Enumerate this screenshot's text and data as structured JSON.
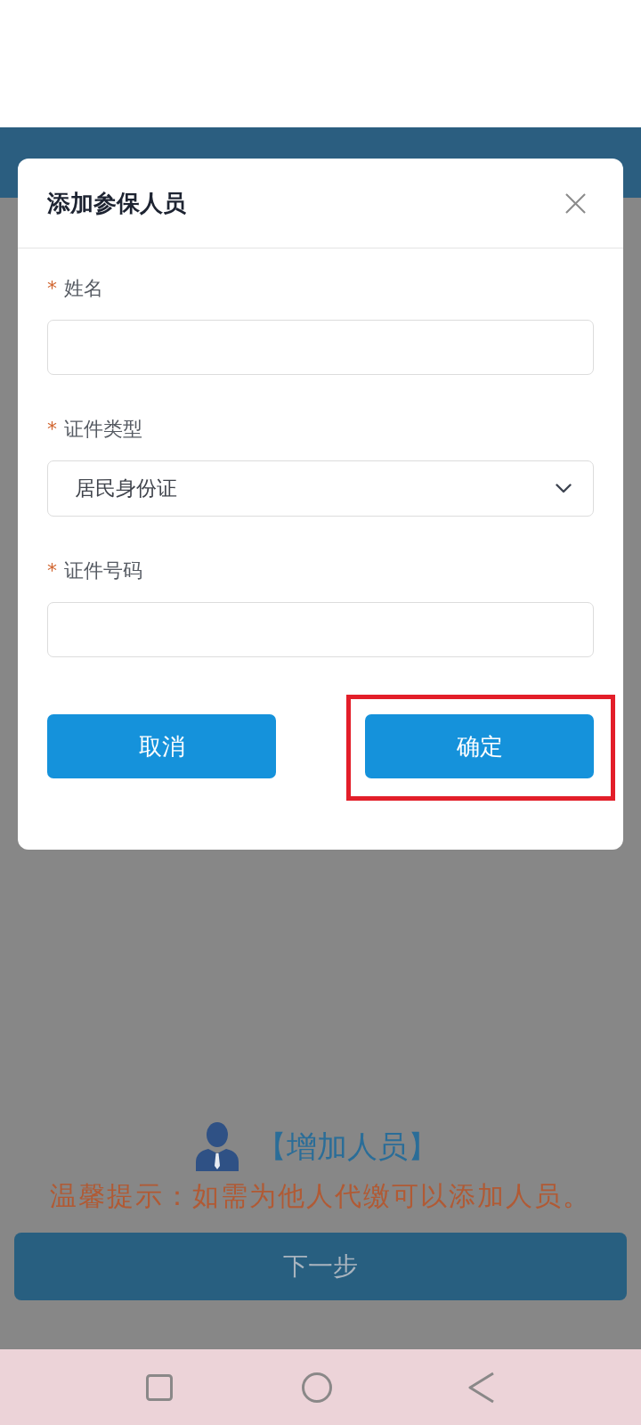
{
  "dialog": {
    "title": "添加参保人员",
    "fields": [
      {
        "kind": "input",
        "required_mark": "*",
        "label": "姓名"
      },
      {
        "kind": "select",
        "required_mark": "*",
        "label": "证件类型",
        "value": "居民身份证"
      },
      {
        "kind": "input",
        "required_mark": "*",
        "label": "证件号码"
      }
    ],
    "buttons": [
      {
        "label": "取消",
        "highlighted": false
      },
      {
        "label": "确定",
        "highlighted": true
      }
    ]
  },
  "add_person": {
    "label": "【增加人员】"
  },
  "tip": "温馨提示：如需为他人代缴可以添加人员。",
  "next_button": {
    "label": "下一步"
  }
}
